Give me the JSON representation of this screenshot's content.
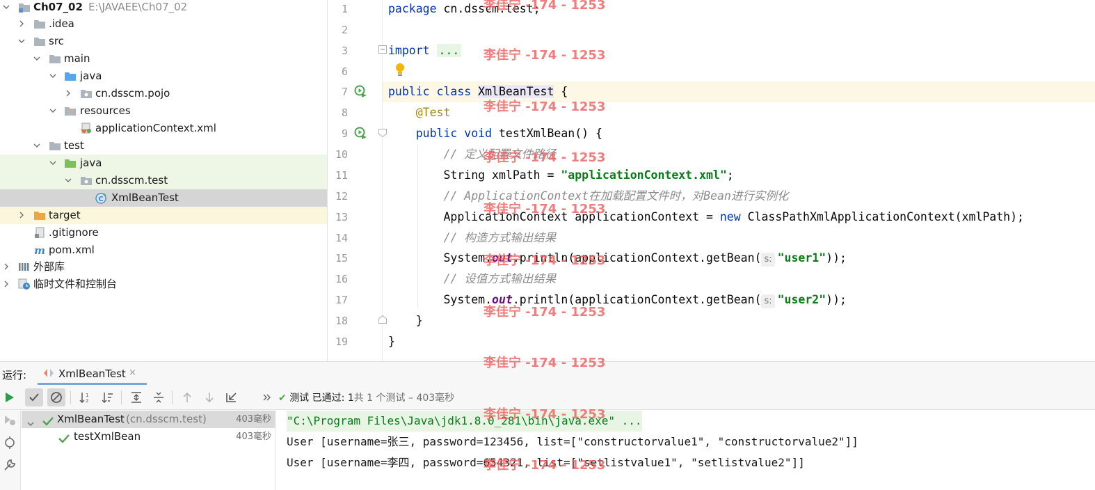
{
  "project_tree": {
    "root_name": "Ch07_02",
    "root_path": "E:\\JAVAEE\\Ch07_02",
    "items": [
      {
        "label": ".idea"
      },
      {
        "label": "src"
      },
      {
        "label": "main"
      },
      {
        "label": "java"
      },
      {
        "label": "cn.dsscm.pojo"
      },
      {
        "label": "resources"
      },
      {
        "label": "applicationContext.xml"
      },
      {
        "label": "test"
      },
      {
        "label": "java"
      },
      {
        "label": "cn.dsscm.test"
      },
      {
        "label": "XmlBeanTest"
      },
      {
        "label": "target"
      },
      {
        "label": ".gitignore"
      },
      {
        "label": "pom.xml"
      },
      {
        "label": "外部库"
      },
      {
        "label": "临时文件和控制台"
      }
    ]
  },
  "editor": {
    "line_numbers": [
      "1",
      "2",
      "3",
      "6",
      "7",
      "8",
      "9",
      "10",
      "11",
      "12",
      "13",
      "14",
      "15",
      "16",
      "17",
      "18",
      "19"
    ],
    "code": {
      "l1_kw": "package",
      "l1_rest": " cn.dsscm.test;",
      "l3_kw": "import",
      "l3_fold": "...",
      "l7_kw": "public class",
      "l7_cls": "XmlBeanTest",
      "l7_rest": " {",
      "l8_ann": "@Test",
      "l9_kw": "public void",
      "l9_rest": " testXmlBean() {",
      "l10_cm": "// 定义配置文件路径",
      "l11_pre": "String xmlPath = ",
      "l11_str": "\"applicationContext.xml\"",
      "l11_post": ";",
      "l12_cm": "// ApplicationContext在加载配置文件时，对Bean进行实例化",
      "l13_pre": "ApplicationContext applicationContext = ",
      "l13_kw": "new",
      "l13_post": " ClassPathXmlApplicationContext(xmlPath);",
      "l14_cm": "// 构造方式输出结果",
      "l15_pre": "System.",
      "l15_out": "out",
      "l15_mid": ".println(applicationContext.getBean(",
      "l15_hint": "s:",
      "l15_str": "\"user1\"",
      "l15_post": "));",
      "l16_cm": "// 设值方式输出结果",
      "l17_pre": "System.",
      "l17_out": "out",
      "l17_mid": ".println(applicationContext.getBean(",
      "l17_hint": "s:",
      "l17_str": "\"user2\"",
      "l17_post": "));",
      "l18": "}",
      "l19": "}"
    }
  },
  "run_panel": {
    "label": "运行:",
    "tab_label": "XmlBeanTest",
    "tab_close": "×",
    "status_check": "✔",
    "status_prefix": "测试 已通过: ",
    "status_count": "1",
    "status_detail": "共 1 个测试 – 403毫秒",
    "tests": [
      {
        "name": "XmlBeanTest",
        "pkg": "(cn.dsscm.test)",
        "time": "403毫秒"
      },
      {
        "name": "testXmlBean",
        "time": "403毫秒"
      }
    ],
    "console": [
      "\"C:\\Program Files\\Java\\jdk1.8.0_281\\bin\\java.exe\" ...",
      "User [username=张三, password=123456, list=[\"constructorvalue1\", \"constructorvalue2\"]]",
      "User [username=李四, password=654321, list=[\"setlistvalue1\", \"setlistvalue2\"]]"
    ]
  },
  "watermark": "李佳宁 -174 - 1253",
  "colors": {
    "keyword": "#0033b3",
    "string": "#067d17",
    "comment": "#8c8c8c",
    "annotation": "#9e880d",
    "pass_green": "#4fa24f",
    "run_green": "#2f9b4b",
    "watermark": "#ef6060",
    "folder_blue": "#59a6e8",
    "folder_gray": "#aeb4bc",
    "folder_green": "#7fbf5a",
    "folder_orange": "#f0a542"
  }
}
